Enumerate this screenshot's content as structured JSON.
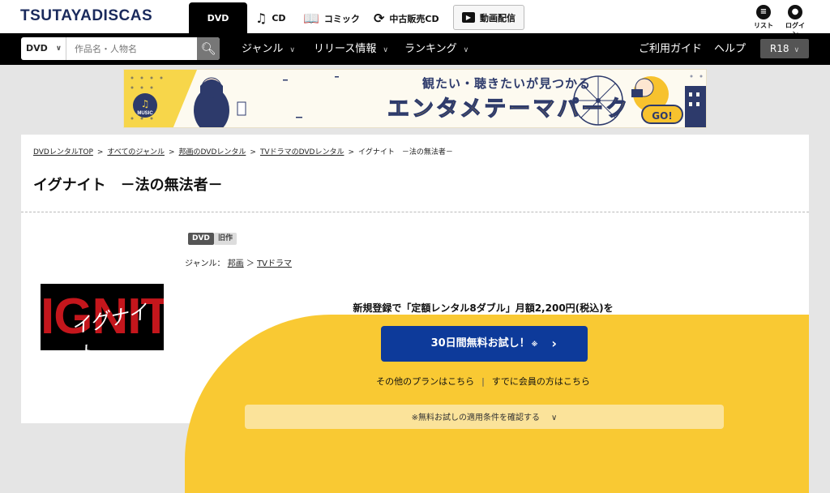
{
  "header": {
    "logo": "TSUTAYADISCAS",
    "tabs": [
      {
        "label": "DVD",
        "icon": "disc-icon"
      },
      {
        "label": "CD",
        "icon": "music-note-icon"
      },
      {
        "label": "コミック",
        "icon": "book-icon"
      },
      {
        "label": "中古販売CD",
        "icon": "recycle-icon"
      },
      {
        "label": "動画配信",
        "icon": "play-icon"
      }
    ],
    "user_icons": [
      {
        "label": "リスト",
        "icon": "list-icon"
      },
      {
        "label": "ログイン",
        "icon": "user-icon"
      }
    ]
  },
  "nav": {
    "search": {
      "category": "DVD",
      "placeholder": "作品名・人物名"
    },
    "items": [
      "ジャンル",
      "リリース情報",
      "ランキング"
    ],
    "right": [
      "ご利用ガイド",
      "ヘルプ"
    ],
    "r18": "R18"
  },
  "banner": {
    "subtitle": "観たい・聴きたいが見つかる",
    "title": "エンタメテーマパーク",
    "go": "GO!",
    "music_badge": "MUSIC"
  },
  "breadcrumb": [
    "DVDレンタルTOP",
    "すべてのジャンル",
    "邦画のDVDレンタル",
    "TVドラマのDVDレンタル",
    "イグナイト　－法の無法者－"
  ],
  "page_title": "イグナイト　－法の無法者－",
  "poster": {
    "title": "IGNITE",
    "script": "イグナイト"
  },
  "badges": [
    "DVD",
    "旧作"
  ],
  "genre": {
    "label": "ジャンル：",
    "items": [
      "邦画",
      "TVドラマ"
    ],
    "sep": "＞"
  },
  "promo": {
    "text": "新規登録で「定額レンタル8ダブル」月額2,200円(税込)を",
    "cta": "30日間無料お試し！",
    "cta_note": "※",
    "link_plans": "その他のプランはこちら",
    "link_member": "すでに会員の方はこちら",
    "confirm": "※無料お試しの適用条件を確認する"
  }
}
